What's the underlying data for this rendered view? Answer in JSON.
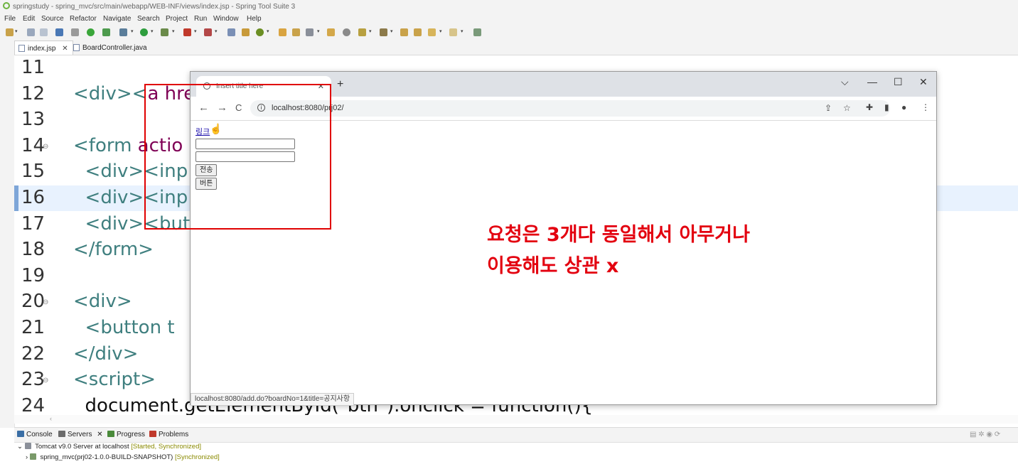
{
  "window": {
    "title": "springstudy - spring_mvc/src/main/webapp/WEB-INF/views/index.jsp - Spring Tool Suite 3"
  },
  "menu": [
    "File",
    "Edit",
    "Source",
    "Refactor",
    "Navigate",
    "Search",
    "Project",
    "Run",
    "Window",
    "Help"
  ],
  "editor_tabs": [
    {
      "label": "index.jsp",
      "active": true,
      "close": "✕"
    },
    {
      "label": "BoardController.java",
      "active": false
    }
  ],
  "code_lines": [
    {
      "num": "11",
      "parts": []
    },
    {
      "num": "12",
      "parts": [
        {
          "c": "<div><",
          "k": "tag"
        },
        {
          "c": "a hre",
          "k": "kw"
        }
      ]
    },
    {
      "num": "13",
      "parts": []
    },
    {
      "num": "14",
      "fold": "⊖",
      "parts": [
        {
          "c": "<form ",
          "k": "tag"
        },
        {
          "c": "actio",
          "k": "kw"
        }
      ]
    },
    {
      "num": "15",
      "parts": [
        {
          "c": "  <div><inp",
          "k": "tag"
        }
      ]
    },
    {
      "num": "16",
      "highlight": true,
      "parts": [
        {
          "c": "  <div><inp",
          "k": "tag"
        }
      ]
    },
    {
      "num": "17",
      "parts": [
        {
          "c": "  <div><but",
          "k": "tag"
        }
      ]
    },
    {
      "num": "18",
      "parts": [
        {
          "c": "</form>",
          "k": "tag"
        }
      ]
    },
    {
      "num": "19",
      "parts": []
    },
    {
      "num": "20",
      "fold": "⊖",
      "parts": [
        {
          "c": "<div>",
          "k": "tag"
        }
      ]
    },
    {
      "num": "21",
      "parts": [
        {
          "c": "  <button t",
          "k": "tag"
        }
      ]
    },
    {
      "num": "22",
      "parts": [
        {
          "c": "</div>",
          "k": "tag"
        }
      ]
    },
    {
      "num": "23",
      "fold": "⊖",
      "parts": [
        {
          "c": "<script>",
          "k": "tag"
        }
      ]
    },
    {
      "num": "24",
      "parts": [
        {
          "c": "  document.getElementById(\"btn\").onclick = function(){",
          "k": "dk"
        }
      ]
    }
  ],
  "bottom_panel": {
    "tabs": [
      {
        "label": "Console",
        "color": "#3a6ea5"
      },
      {
        "label": "Servers",
        "color": "#6b6b6b",
        "close": "✕"
      },
      {
        "label": "Progress",
        "color": "#4a8a3a"
      },
      {
        "label": "Problems",
        "color": "#c0392b"
      }
    ],
    "server": {
      "name": "Tomcat v9.0 Server at localhost",
      "status": "[Started, Synchronized]"
    },
    "module": {
      "name": "spring_mvc(prj02-1.0.0-BUILD-SNAPSHOT)",
      "status": "[Synchronized]"
    }
  },
  "browser": {
    "tab_title": "Insert title here",
    "tab_close": "✕",
    "new_tab": "+",
    "controls": [
      "⌵",
      "—",
      "☐",
      "✕"
    ],
    "nav": [
      "←",
      "→",
      "C"
    ],
    "info_icon": "i",
    "url": "localhost:8080/prj02/",
    "toolbar_icons": [
      "⇪",
      "☆",
      "✚",
      "▮",
      "●",
      "⋮"
    ],
    "page": {
      "link_text": "링크",
      "submit_label": "전송",
      "button_label": "버튼"
    },
    "status_url": "localhost:8080/add.do?boardNo=1&title=공지사항"
  },
  "annotation": {
    "line1": "요청은 3개다 동일해서 아무거나",
    "line2": "이용해도 상관 x",
    "color": "#e3000f"
  }
}
